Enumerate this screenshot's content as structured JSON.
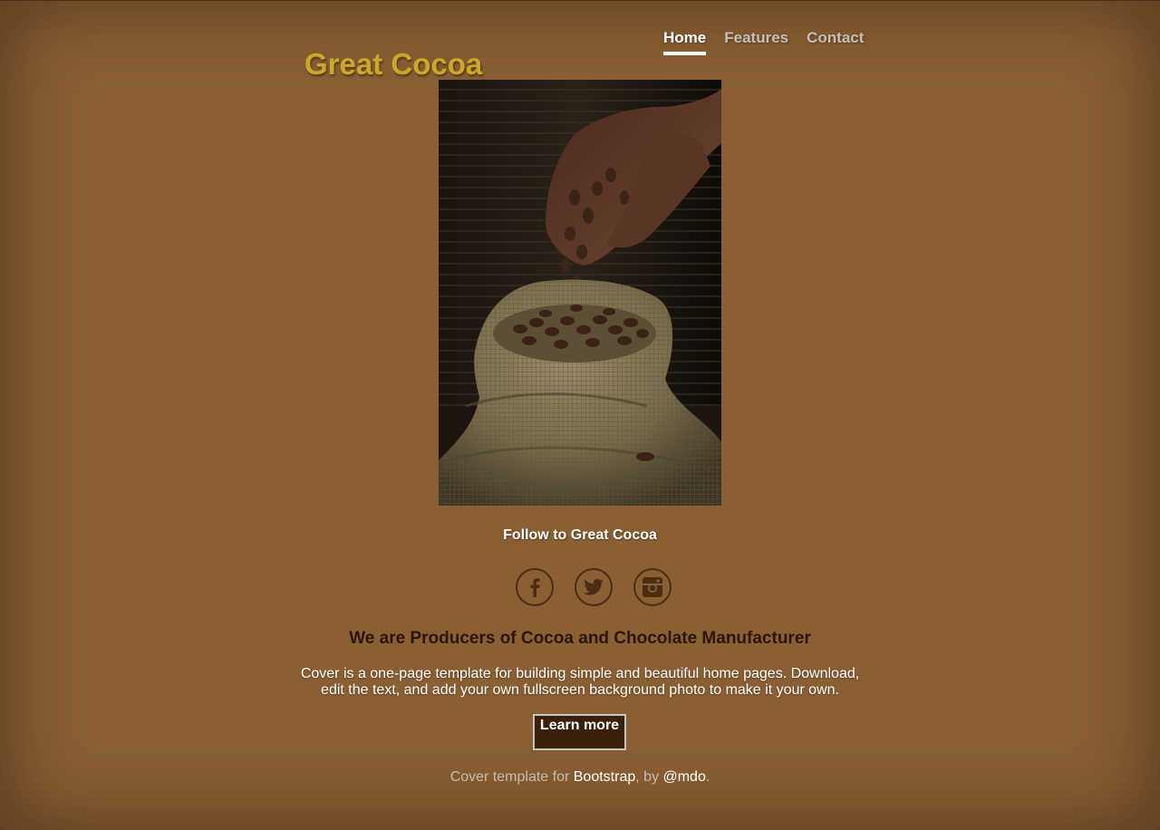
{
  "brand": {
    "title": "Great Cocoa"
  },
  "nav": {
    "items": [
      {
        "label": "Home",
        "active": true
      },
      {
        "label": "Features",
        "active": false
      },
      {
        "label": "Contact",
        "active": false
      }
    ]
  },
  "hero": {
    "image": "hands-pouring-cocoa-beans-into-burlap-sack"
  },
  "follow": {
    "text": "Follow to Great Cocoa"
  },
  "social": {
    "icons": [
      "facebook-icon",
      "twitter-icon",
      "instagram-icon"
    ]
  },
  "main": {
    "heading": "We are Producers of Cocoa and Chocolate Manufacturer",
    "lead": "Cover is a one-page template for building simple and beautiful home pages. Download, edit the text, and add your own fullscreen background photo to make it your own.",
    "button_label": "Learn more"
  },
  "footer": {
    "prefix": "Cover template for ",
    "link1": "Bootstrap",
    "middle": ", by ",
    "link2": "@mdo",
    "suffix": "."
  },
  "colors": {
    "background": "#8a5f34",
    "brand": "#c9a92a",
    "button": "#3a1f0a",
    "heading": "#2a1606"
  }
}
